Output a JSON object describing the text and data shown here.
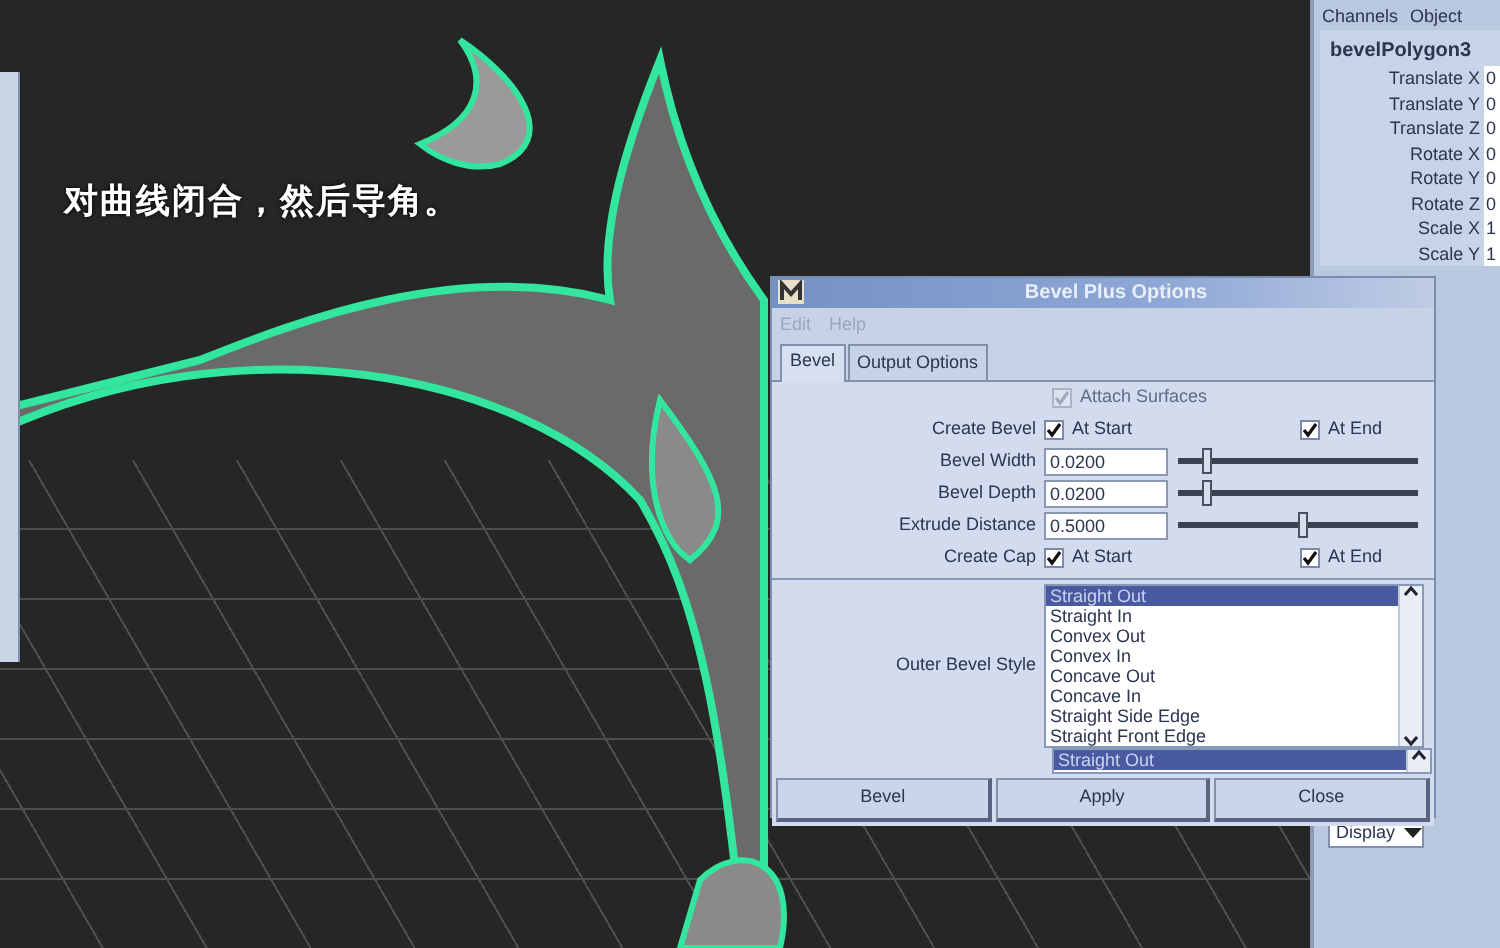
{
  "caption": "对曲线闭合，然后导角。",
  "channel_box": {
    "menus": [
      "Channels",
      "Object"
    ],
    "node": "bevelPolygon3",
    "attributes": [
      {
        "label": "Translate X",
        "value": "0"
      },
      {
        "label": "Translate Y",
        "value": "0"
      },
      {
        "label": "Translate Z",
        "value": "0"
      },
      {
        "label": "Rotate X",
        "value": "0"
      },
      {
        "label": "Rotate Y",
        "value": "0"
      },
      {
        "label": "Rotate Z",
        "value": "0"
      },
      {
        "label": "Scale X",
        "value": "1"
      },
      {
        "label": "Scale Y",
        "value": "1"
      }
    ],
    "display_dropdown": "Display"
  },
  "dialog": {
    "title": "Bevel Plus Options",
    "menus": [
      {
        "label": "Edit",
        "disabled": true
      },
      {
        "label": "Help",
        "disabled": true
      }
    ],
    "tabs": [
      {
        "label": "Bevel",
        "selected": true
      },
      {
        "label": "Output Options",
        "selected": false
      }
    ],
    "attach_surfaces": {
      "label": "Attach Surfaces",
      "checked": true,
      "disabled": true
    },
    "rows": [
      {
        "kind": "checks",
        "label": "Create Bevel",
        "options": [
          {
            "label": "At Start",
            "checked": true
          },
          {
            "label": "At End",
            "checked": true
          }
        ]
      },
      {
        "kind": "slider",
        "label": "Bevel Width",
        "value": "0.0200",
        "level": 0.1
      },
      {
        "kind": "slider",
        "label": "Bevel Depth",
        "value": "0.0200",
        "level": 0.1
      },
      {
        "kind": "slider",
        "label": "Extrude Distance",
        "value": "0.5000",
        "level": 0.52
      },
      {
        "kind": "checks",
        "label": "Create Cap",
        "options": [
          {
            "label": "At Start",
            "checked": true
          },
          {
            "label": "At End",
            "checked": true
          }
        ]
      }
    ],
    "outer_bevel_style": {
      "label": "Outer Bevel Style",
      "items": [
        {
          "label": "Straight Out",
          "selected": true
        },
        {
          "label": "Straight In",
          "selected": false
        },
        {
          "label": "Convex Out",
          "selected": false
        },
        {
          "label": "Convex In",
          "selected": false
        },
        {
          "label": "Concave Out",
          "selected": false
        },
        {
          "label": "Concave In",
          "selected": false
        },
        {
          "label": "Straight Side Edge",
          "selected": false
        },
        {
          "label": "Straight Front Edge",
          "selected": false
        }
      ]
    },
    "inner_list": {
      "items": [
        {
          "label": "Straight Out",
          "selected": true
        }
      ]
    },
    "buttons": [
      "Bevel",
      "Apply",
      "Close"
    ]
  }
}
